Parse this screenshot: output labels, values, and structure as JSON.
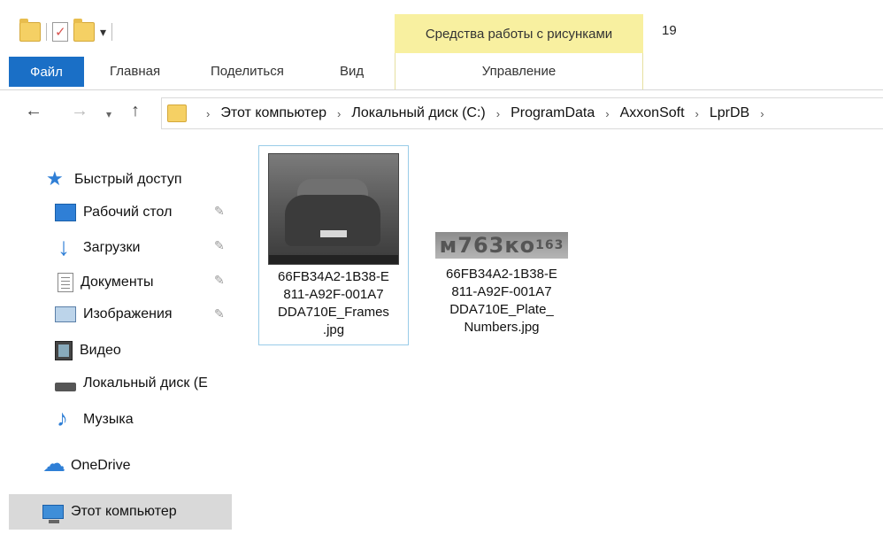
{
  "title_bar": {
    "contextual_tab": "Средства работы с рисунками",
    "window_title": "19"
  },
  "ribbon": {
    "tabs": [
      "Файл",
      "Главная",
      "Поделиться",
      "Вид"
    ],
    "contextual_subtab": "Управление"
  },
  "address": {
    "crumbs": [
      "Этот компьютер",
      "Локальный диск (C:)",
      "ProgramData",
      "AxxonSoft",
      "LprDB"
    ]
  },
  "sidebar": {
    "items": [
      {
        "label": "Быстрый доступ",
        "icon": "star-icon"
      },
      {
        "label": "Рабочий стол",
        "icon": "desktop-icon",
        "pinned": true
      },
      {
        "label": "Загрузки",
        "icon": "downloads-icon",
        "pinned": true
      },
      {
        "label": "Документы",
        "icon": "documents-icon",
        "pinned": true
      },
      {
        "label": "Изображения",
        "icon": "pictures-icon",
        "pinned": true
      },
      {
        "label": "Видео",
        "icon": "video-icon"
      },
      {
        "label": "Локальный диск (E",
        "icon": "disk-icon"
      },
      {
        "label": "Музыка",
        "icon": "music-icon"
      },
      {
        "label": "OneDrive",
        "icon": "cloud-icon"
      },
      {
        "label": "Этот компьютер",
        "icon": "computer-icon",
        "selected": true
      }
    ]
  },
  "files": [
    {
      "name": "66FB34A2-1B38-E811-A92F-001A7DDA710E_Frames.jpg",
      "name_lines": [
        "66FB34A2-1B38-E",
        "811-A92F-001A7",
        "DDA710E_Frames",
        ".jpg"
      ],
      "selected": true
    },
    {
      "name": "66FB34A2-1B38-E811-A92F-001A7DDA710E_Plate_Numbers.jpg",
      "name_lines": [
        "66FB34A2-1B38-E",
        "811-A92F-001A7",
        "DDA710E_Plate_",
        "Numbers.jpg"
      ],
      "plate_text": "м763ко",
      "plate_region": "163"
    }
  ]
}
